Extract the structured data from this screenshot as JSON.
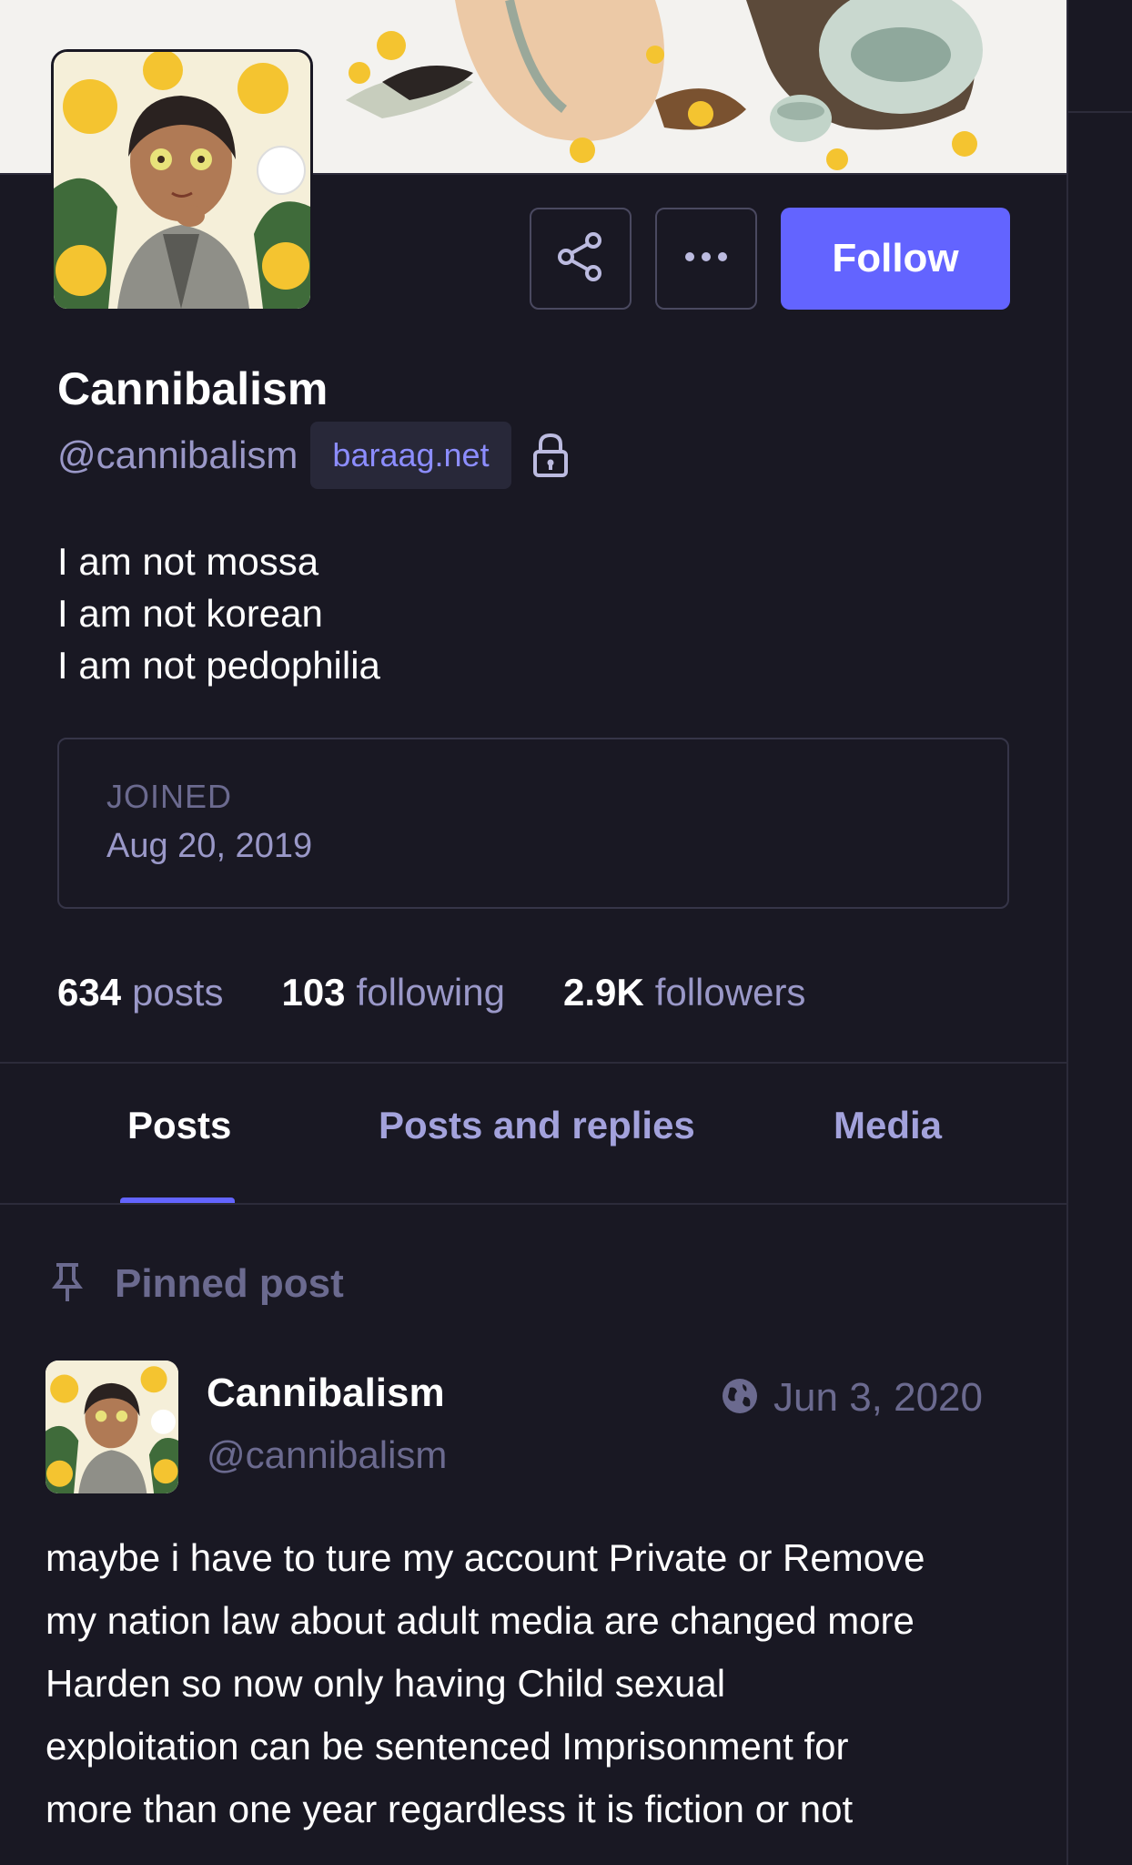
{
  "profile": {
    "display_name": "Cannibalism",
    "handle": "@cannibalism",
    "domain": "baraag.net",
    "bio_lines": [
      "I am not mossa",
      "I am not korean",
      "I am not pedophilia"
    ],
    "joined_label": "JOINED",
    "joined_date": "Aug 20, 2019"
  },
  "actions": {
    "share_icon": "share-icon",
    "more_icon": "more-icon",
    "follow_label": "Follow"
  },
  "stats": [
    {
      "num": "634",
      "label": "posts"
    },
    {
      "num": "103",
      "label": "following"
    },
    {
      "num": "2.9K",
      "label": "followers"
    }
  ],
  "tabs": [
    {
      "label": "Posts",
      "active": true
    },
    {
      "label": "Posts and replies",
      "active": false
    },
    {
      "label": "Media",
      "active": false
    }
  ],
  "pinned": {
    "label": "Pinned post",
    "post": {
      "display_name": "Cannibalism",
      "handle": "@cannibalism",
      "date": "Jun 3, 2020",
      "visibility_icon": "globe-icon",
      "body_lines": [
        "maybe i have to ture my account Private or Remove",
        "my nation law about adult media are changed more",
        "Harden so now only having Child sexual",
        "exploitation can be sentenced Imprisonment for",
        "more than one year regardless it is fiction or not"
      ]
    }
  },
  "colors": {
    "background": "#191823",
    "accent": "#6364ff",
    "muted_text": "#9a98c8",
    "dim_text": "#6b6a8f",
    "border": "#363548"
  }
}
